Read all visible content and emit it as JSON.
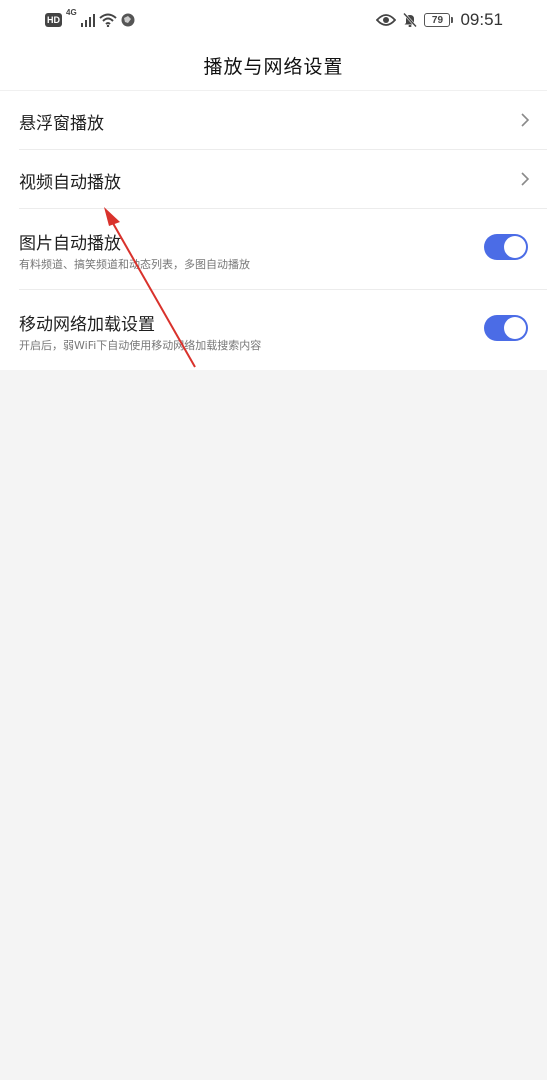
{
  "status_bar": {
    "hd": "HD",
    "network": "4G",
    "battery": "79",
    "time": "09:51"
  },
  "header": {
    "title": "播放与网络设置"
  },
  "settings": [
    {
      "label": "悬浮窗播放",
      "type": "link"
    },
    {
      "label": "视频自动播放",
      "type": "link"
    },
    {
      "label": "图片自动播放",
      "subtitle": "有料频道、搞笑频道和动态列表，多图自动播放",
      "type": "toggle",
      "on": true
    },
    {
      "label": "移动网络加载设置",
      "subtitle": "开启后，弱WiFi下自动使用移动网络加载搜索内容",
      "type": "toggle",
      "on": true
    }
  ],
  "colors": {
    "toggle_on": "#4b6ce6",
    "annotation_arrow": "#d9322c"
  }
}
